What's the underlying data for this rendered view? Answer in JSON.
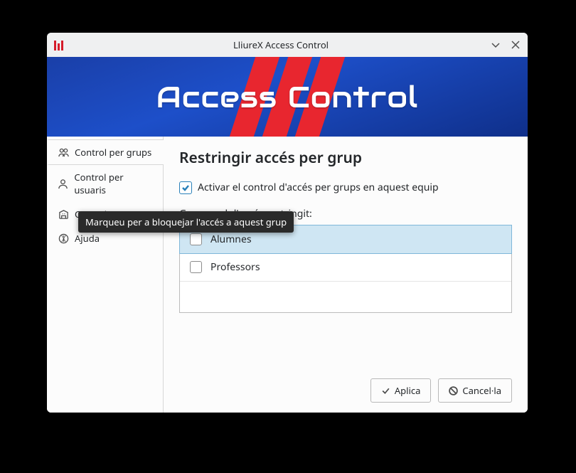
{
  "titlebar": {
    "title": "LliureX Access Control"
  },
  "banner": {
    "title": "Access Control"
  },
  "sidebar": {
    "items": [
      {
        "label": "Control per grups",
        "active": true
      },
      {
        "label": "Control per usuaris",
        "active": false
      },
      {
        "label": "Control per centre",
        "active": false
      },
      {
        "label": "Ajuda",
        "active": false
      }
    ]
  },
  "main": {
    "heading": "Restringir accés per grup",
    "enable_checkbox_label": "Activar el control d'accés per grups en aquest equip",
    "enable_checkbox_checked": true,
    "groups_label": "Grups amb l'accés restringit:",
    "groups": [
      {
        "label": "Alumnes",
        "checked": false,
        "hovered": true
      },
      {
        "label": "Professors",
        "checked": false,
        "hovered": false
      }
    ]
  },
  "tooltip": {
    "text": "Marqueu per a bloquejar l'accés a aquest grup"
  },
  "footer": {
    "apply": "Aplica",
    "cancel": "Cancel·la"
  }
}
